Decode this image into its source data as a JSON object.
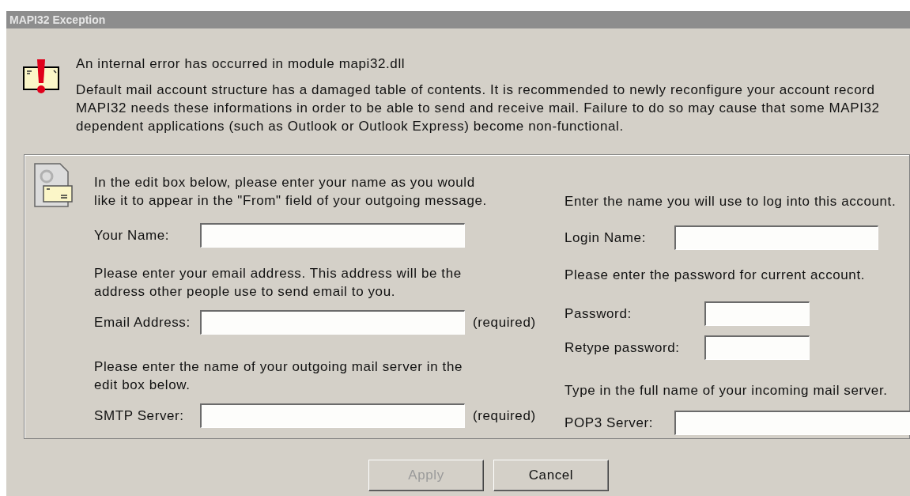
{
  "window": {
    "title": "MAPI32 Exception"
  },
  "error": {
    "heading": "An internal error has occurred in module mapi32.dll",
    "lines": [
      "Default mail account structure has a damaged table of contents. It is recommended to newly reconfigure your account record",
      "MAPI32 needs these informations in order to be able to send and receive mail. Failure to do so may cause that some MAPI32",
      "dependent applications (such as Outlook or Outlook Express) become non-functional."
    ]
  },
  "left": [
    {
      "instructions": [
        "In the edit box below, please enter your name as you would",
        "like it to appear in the \"From\" field of your outgoing message."
      ],
      "fields": [
        {
          "label": "Your Name:"
        }
      ]
    },
    {
      "instructions": [
        "Please enter your email address. This address will be the",
        "address other people use to send email to you."
      ],
      "fields": [
        {
          "label": "Email Address:",
          "note": "(required)"
        }
      ]
    },
    {
      "instructions": [
        "Please enter the name of your outgoing mail server in the",
        "edit box below."
      ],
      "fields": [
        {
          "label": "SMTP Server:",
          "note": "(required)"
        }
      ]
    }
  ],
  "right": [
    {
      "instructions": [
        "Enter the name you will use to log into this account."
      ],
      "fields": [
        {
          "label": "Login Name:",
          "kind": "wide"
        }
      ]
    },
    {
      "instructions": [
        "Please enter the password for current account."
      ],
      "fields": [
        {
          "label": "Password:",
          "kind": "short"
        },
        {
          "label": "Retype password:",
          "kind": "short"
        }
      ]
    },
    {
      "instructions": [
        "Type in the full name of your incoming mail server."
      ],
      "fields": [
        {
          "label": "POP3 Server:",
          "kind": "cut"
        }
      ]
    }
  ],
  "buttons": [
    {
      "label": "Apply",
      "disabled": true
    },
    {
      "label": "Cancel",
      "disabled": false
    }
  ]
}
